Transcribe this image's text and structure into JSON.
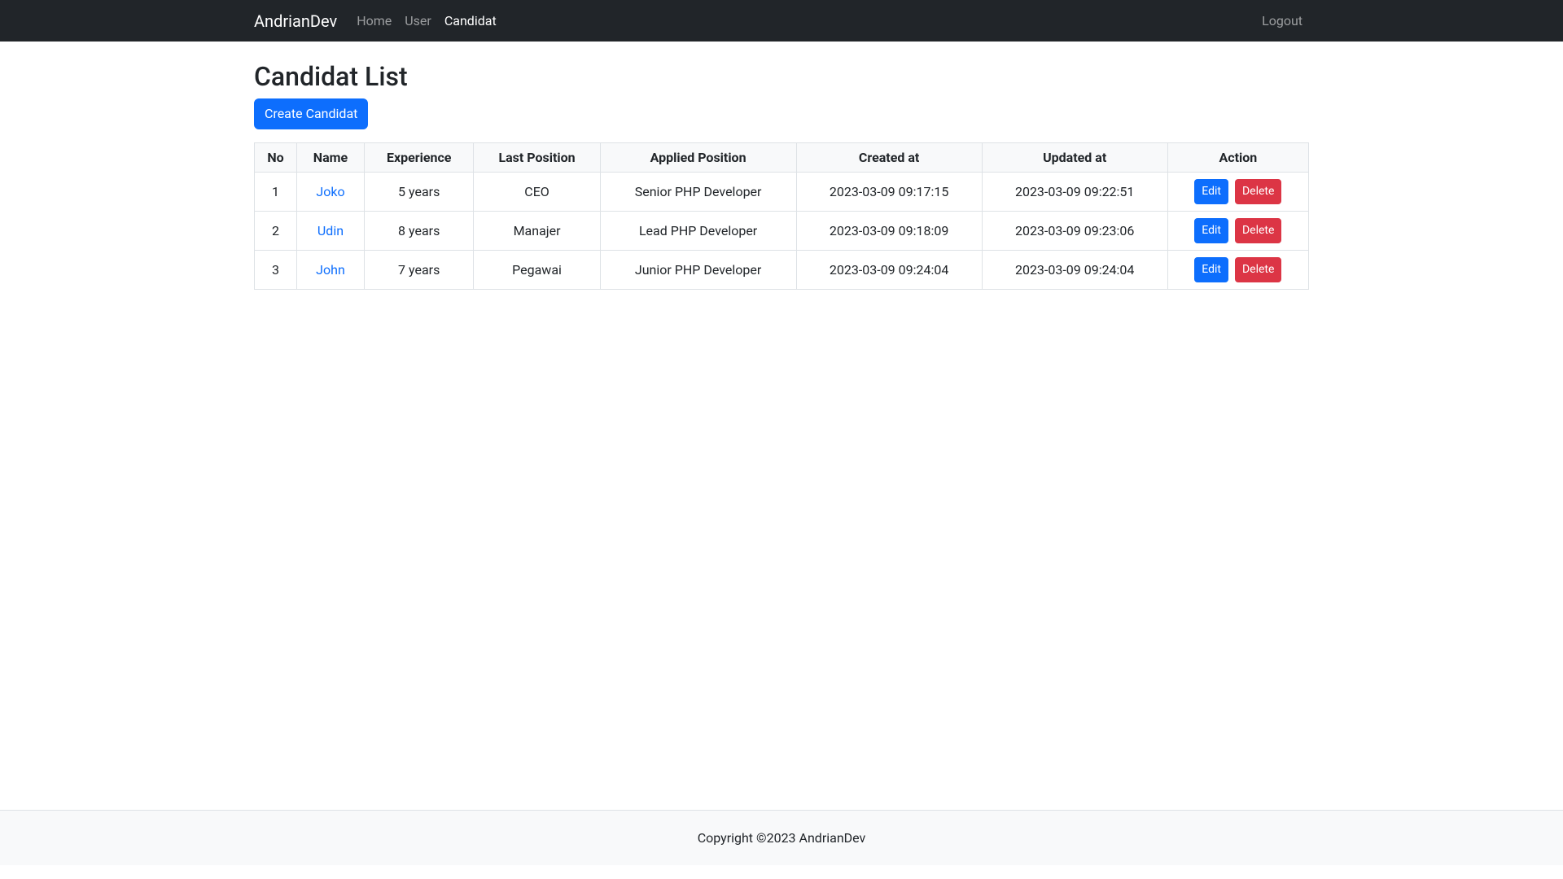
{
  "navbar": {
    "brand": "AndrianDev",
    "links": [
      {
        "label": "Home",
        "active": false
      },
      {
        "label": "User",
        "active": false
      },
      {
        "label": "Candidat",
        "active": true
      }
    ],
    "logout": "Logout"
  },
  "page": {
    "title": "Candidat List",
    "create_button": "Create Candidat"
  },
  "table": {
    "headers": {
      "no": "No",
      "name": "Name",
      "experience": "Experience",
      "last_position": "Last Position",
      "applied_position": "Applied Position",
      "created_at": "Created at",
      "updated_at": "Updated at",
      "action": "Action"
    },
    "rows": [
      {
        "no": "1",
        "name": "Joko",
        "experience": "5 years",
        "last_position": "CEO",
        "applied_position": "Senior PHP Developer",
        "created_at": "2023-03-09 09:17:15",
        "updated_at": "2023-03-09 09:22:51"
      },
      {
        "no": "2",
        "name": "Udin",
        "experience": "8 years",
        "last_position": "Manajer",
        "applied_position": "Lead PHP Developer",
        "created_at": "2023-03-09 09:18:09",
        "updated_at": "2023-03-09 09:23:06"
      },
      {
        "no": "3",
        "name": "John",
        "experience": "7 years",
        "last_position": "Pegawai",
        "applied_position": "Junior PHP Developer",
        "created_at": "2023-03-09 09:24:04",
        "updated_at": "2023-03-09 09:24:04"
      }
    ],
    "actions": {
      "edit": "Edit",
      "delete": "Delete"
    }
  },
  "footer": {
    "text": "Copyright ©2023 AndrianDev"
  }
}
